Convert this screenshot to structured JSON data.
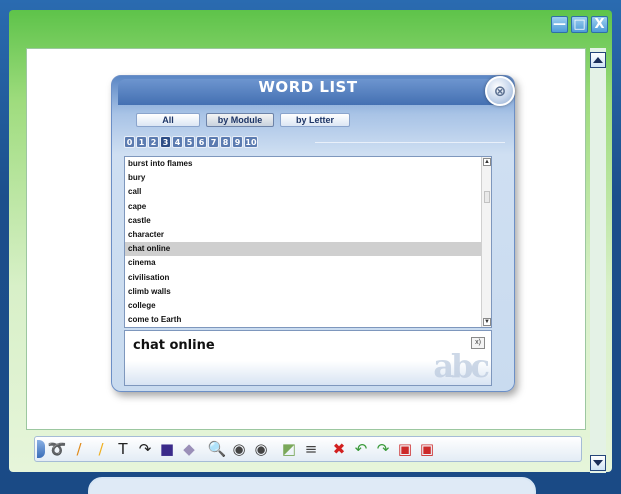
{
  "window": {
    "controls": {
      "minimize": "—",
      "maximize": "□",
      "close": "X"
    }
  },
  "dialog": {
    "title": "WORD LIST",
    "close_icon": "⊗",
    "tabs": [
      {
        "label": "All"
      },
      {
        "label": "by Module"
      },
      {
        "label": "by Letter"
      }
    ],
    "numbers": [
      "0",
      "1",
      "2",
      "3",
      "4",
      "5",
      "6",
      "7",
      "8",
      "9",
      "10"
    ],
    "selected_number": "3",
    "words": [
      "burst into flames",
      "bury",
      "call",
      "cape",
      "castle",
      "character",
      "chat online",
      "cinema",
      "civilisation",
      "climb walls",
      "college",
      "come to Earth"
    ],
    "selected_word": "chat online",
    "detail_word": "chat online",
    "audio_button": "x)",
    "logo_text": "abc"
  },
  "toolbar": {
    "tools": [
      {
        "name": "lasso-icon",
        "glyph": "➰",
        "color": "#5a6f90"
      },
      {
        "name": "pencil-icon",
        "glyph": "/",
        "color": "#e08a1a"
      },
      {
        "name": "highlighter-icon",
        "glyph": "/",
        "color": "#f0b020"
      },
      {
        "name": "text-icon",
        "glyph": "T",
        "color": "#222222"
      },
      {
        "name": "curve-icon",
        "glyph": "↷",
        "color": "#222222"
      },
      {
        "name": "fill-icon",
        "glyph": "■",
        "color": "#3a2a8a"
      },
      {
        "name": "eraser-icon",
        "glyph": "◆",
        "color": "#9a8fb8"
      },
      {
        "name": "zoom-icon",
        "glyph": "🔍",
        "color": "#446688"
      },
      {
        "name": "spotlight-icon",
        "glyph": "◉",
        "color": "#444444"
      },
      {
        "name": "reveal-icon",
        "glyph": "◉",
        "color": "#444444"
      },
      {
        "name": "screen-shade-icon",
        "glyph": "◩",
        "color": "#7aa85a"
      },
      {
        "name": "divider-icon",
        "glyph": "≡",
        "color": "#444444"
      },
      {
        "name": "delete-icon",
        "glyph": "✖",
        "color": "#d22020"
      },
      {
        "name": "undo-icon",
        "glyph": "↶",
        "color": "#3a9a3a"
      },
      {
        "name": "redo-icon",
        "glyph": "↷",
        "color": "#3a9a3a"
      },
      {
        "name": "save-icon",
        "glyph": "▣",
        "color": "#cc2a2a"
      },
      {
        "name": "save-as-icon",
        "glyph": "▣",
        "color": "#cc2a2a"
      }
    ]
  }
}
